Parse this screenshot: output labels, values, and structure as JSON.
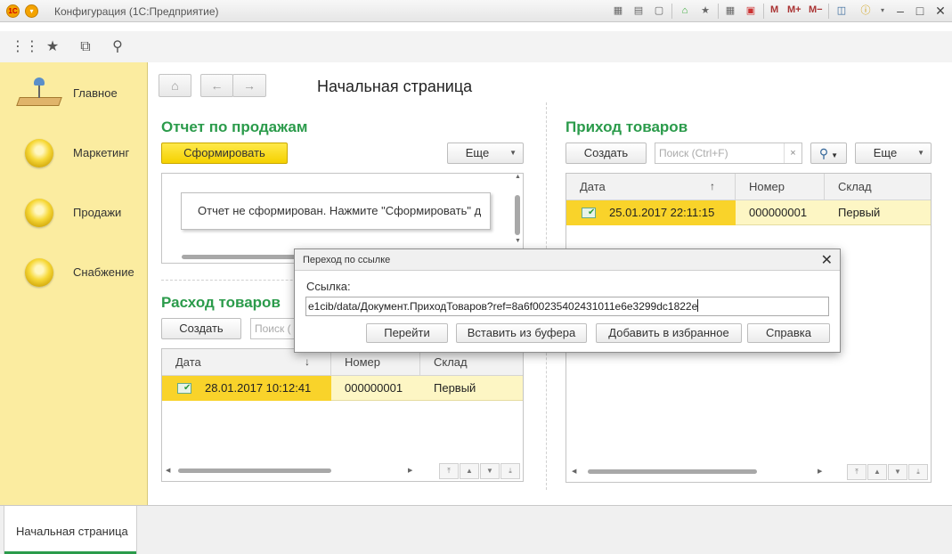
{
  "window": {
    "title": "Конфигурация  (1С:Предприятие)",
    "logo": "1С"
  },
  "titlebar_icons": [
    "save-icon",
    "print-icon",
    "preview-icon",
    "home-icon",
    "bookmark-icon",
    "calculator-icon",
    "calendar-icon",
    "info-icon",
    "minimize-icon",
    "maximize-icon",
    "close-icon"
  ],
  "memory": {
    "m": "M",
    "mplus": "M+",
    "mminus": "M−"
  },
  "toolbar": [
    "apps-grid-icon",
    "favorites-star-icon",
    "history-icon",
    "search-icon"
  ],
  "sidebar": {
    "items": [
      {
        "label": "Главное",
        "icon": "desk-lamp-icon"
      },
      {
        "label": "Маркетинг",
        "icon": "yellow-ball-icon"
      },
      {
        "label": "Продажи",
        "icon": "yellow-ball-icon"
      },
      {
        "label": "Снабжение",
        "icon": "yellow-ball-icon"
      }
    ]
  },
  "nav": {
    "home": "⌂",
    "back": "←",
    "forward": "→"
  },
  "page": {
    "title": "Начальная страница"
  },
  "sales_report": {
    "title": "Отчет по продажам",
    "generate_label": "Сформировать",
    "more_label": "Еще",
    "note": "Отчет не сформирован. Нажмите \"Сформировать\" д"
  },
  "goods_out": {
    "title": "Расход товаров",
    "create_label": "Создать",
    "search_placeholder": "Поиск (",
    "columns": [
      "Дата",
      "Номер",
      "Склад"
    ],
    "sort_indicator": "↓",
    "rows": [
      {
        "date": "28.01.2017 10:12:41",
        "number": "000000001",
        "warehouse": "Первый"
      }
    ]
  },
  "goods_in": {
    "title": "Приход товаров",
    "create_label": "Создать",
    "search_placeholder": "Поиск (Ctrl+F)",
    "clear_label": "×",
    "more_label": "Еще",
    "columns": [
      "Дата",
      "Номер",
      "Склад"
    ],
    "sort_indicator": "↑",
    "rows": [
      {
        "date": "25.01.2017 22:11:15",
        "number": "000000001",
        "warehouse": "Первый"
      }
    ]
  },
  "dialog": {
    "title": "Переход по ссылке",
    "close_label": "✕",
    "link_label": "Ссылка:",
    "link_value": "e1cib/data/Документ.ПриходТоваров?ref=8a6f00235402431011e6e3299dc1822e",
    "buttons": {
      "go": "Перейти",
      "paste": "Вставить из буфера",
      "favorite": "Добавить в избранное",
      "help": "Справка"
    }
  },
  "tabs": [
    {
      "label": "Начальная страница"
    }
  ],
  "colors": {
    "accent_green": "#2b9b4b",
    "sidebar_bg": "#fbeca0",
    "selected_row": "#fdf6c4",
    "selected_cell": "#f9d32a",
    "primary_button": "#f5d100"
  }
}
